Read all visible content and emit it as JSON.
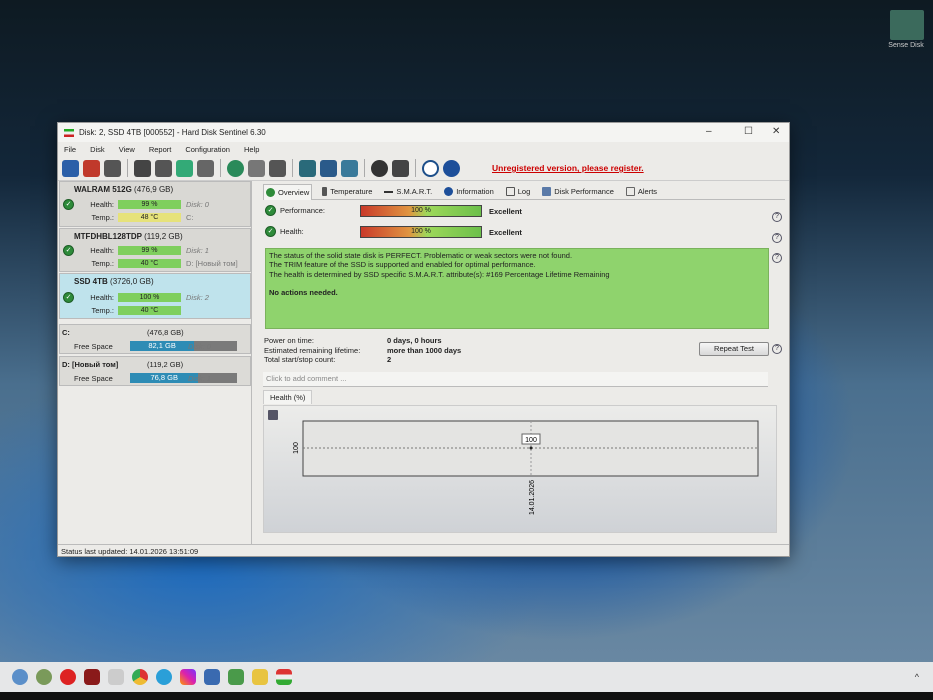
{
  "desktop": {
    "icon_label": "Sense Disk"
  },
  "window": {
    "title": "Disk: 2, SSD 4TB [000552]  -  Hard Disk Sentinel 6.30",
    "controls": [
      "–",
      "☐",
      "✕"
    ]
  },
  "menu": [
    "File",
    "Disk",
    "View",
    "Report",
    "Configuration",
    "Help"
  ],
  "toolbar": {
    "unregistered": "Unregistered version, please register."
  },
  "disks": [
    {
      "name": "WALRAM 512G",
      "size": "(476,9 GB)",
      "health_label": "Health:",
      "health": "99 %",
      "temp_label": "Temp.:",
      "temp": "48 °C",
      "disk": "Disk: 0",
      "volume": "C:"
    },
    {
      "name": "MTFDHBL128TDP",
      "size": "(119,2 GB)",
      "health_label": "Health:",
      "health": "99 %",
      "temp_label": "Temp.:",
      "temp": "40 °C",
      "disk": "Disk: 1",
      "volume": "D: [Новый том]"
    },
    {
      "name": "SSD 4TB",
      "size": "(3726,0 GB)",
      "health_label": "Health:",
      "health": "100 %",
      "temp_label": "Temp.:",
      "temp": "40 °C",
      "disk": "Disk: 2",
      "volume": ""
    }
  ],
  "partitions": [
    {
      "name": "C:",
      "size": "(476,8 GB)",
      "label": "Free Space",
      "free": "82,1 GB",
      "free_fraction": 0.17,
      "disk": "Disk: 0"
    },
    {
      "name": "D: [Новый том]",
      "size": "(119,2 GB)",
      "label": "Free Space",
      "free": "76,8 GB",
      "free_fraction": 0.64,
      "disk": "Disk: 1"
    }
  ],
  "tabs": [
    "Overview",
    "Temperature",
    "S.M.A.R.T.",
    "Information",
    "Log",
    "Disk Performance",
    "Alerts"
  ],
  "overview": {
    "performance_label": "Performance:",
    "performance": "100 %",
    "performance_rating": "Excellent",
    "health_label": "Health:",
    "health": "100 %",
    "health_rating": "Excellent",
    "status_lines": [
      "The status of the solid state disk is PERFECT. Problematic or weak sectors were not found.",
      "The TRIM feature of the SSD is supported and enabled for optimal performance.",
      "The health is determined by SSD specific S.M.A.R.T. attribute(s):  #169 Percentage Lifetime Remaining"
    ],
    "actions": "No actions needed.",
    "power_on_label": "Power on time:",
    "power_on": "0 days, 0 hours",
    "lifetime_label": "Estimated remaining lifetime:",
    "lifetime": "more than 1000 days",
    "startstop_label": "Total start/stop count:",
    "startstop": "2",
    "repeat_test": "Repeat Test",
    "comment_placeholder": "Click to add comment ..."
  },
  "chart_data": {
    "type": "line",
    "title": "Health (%)",
    "x": [
      "14.01.2026"
    ],
    "values": [
      100
    ],
    "point_label": "100",
    "ytick": "100"
  },
  "statusbar": "Status last updated: 14.01.2026 13:51:09"
}
